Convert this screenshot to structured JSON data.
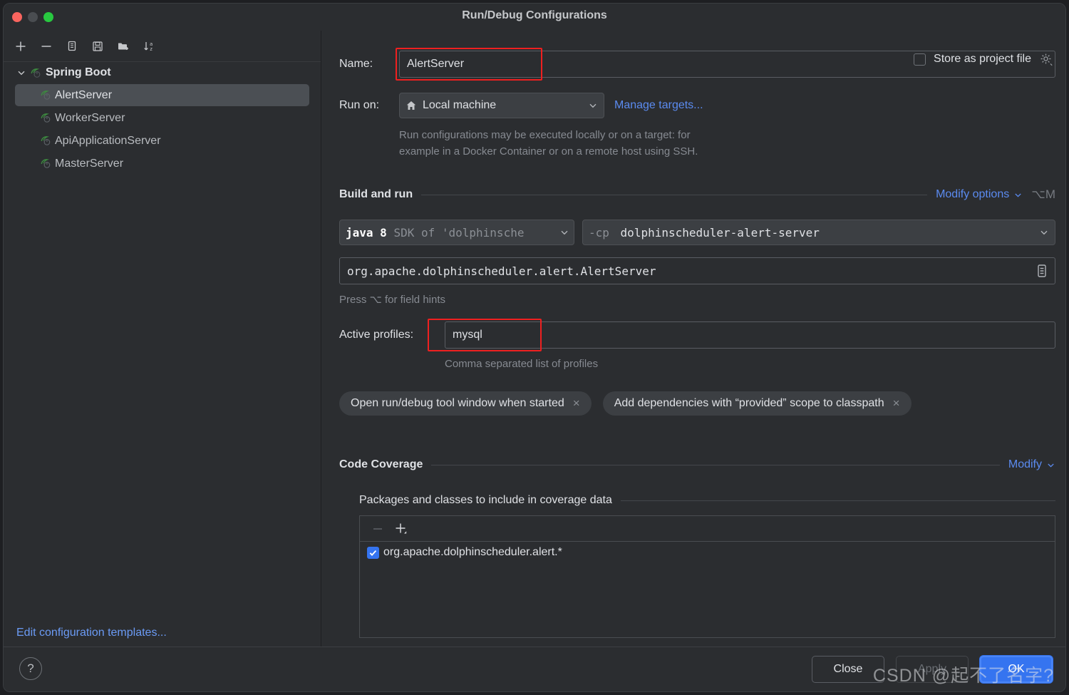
{
  "window": {
    "title": "Run/Debug Configurations",
    "traffic_lights": [
      "close",
      "minimize",
      "zoom"
    ]
  },
  "sidebar": {
    "toolbar": [
      {
        "name": "add-configuration-button",
        "icon": "plus-icon"
      },
      {
        "name": "remove-configuration-button",
        "icon": "minus-icon"
      },
      {
        "name": "copy-configuration-button",
        "icon": "copy-icon"
      },
      {
        "name": "save-configuration-button",
        "icon": "save-icon"
      },
      {
        "name": "move-into-folder-button",
        "icon": "folder-add-icon"
      },
      {
        "name": "sort-configurations-button",
        "icon": "sort-az-icon"
      }
    ],
    "group": {
      "label": "Spring Boot",
      "icon": "spring-boot-icon",
      "expanded": true
    },
    "items": [
      {
        "label": "AlertServer",
        "selected": true
      },
      {
        "label": "WorkerServer",
        "selected": false
      },
      {
        "label": "ApiApplicationServer",
        "selected": false
      },
      {
        "label": "MasterServer",
        "selected": false
      }
    ],
    "edit_templates_link": "Edit configuration templates..."
  },
  "main": {
    "name_label": "Name:",
    "name_value": "AlertServer",
    "name_placeholder": "",
    "store_as_project_file": {
      "label": "Store as project file",
      "checked": false,
      "gear_icon": "gear-icon"
    },
    "run_on_label": "Run on:",
    "run_on_value": "Local machine",
    "run_on_icon": "home-icon",
    "manage_targets_link": "Manage targets...",
    "run_on_hint_line1": "Run configurations may be executed locally or on a target: for",
    "run_on_hint_line2": "example in a Docker Container or on a remote host using SSH.",
    "build_and_run": {
      "section_title": "Build and run",
      "modify_options_link": "Modify options",
      "modify_options_shortcut": "⌥M",
      "jdk_value_strong": "java 8",
      "jdk_value_dim": "SDK of 'dolphinsche",
      "classpath_prefix": "-cp",
      "classpath_value": "dolphinscheduler-alert-server",
      "main_class_value": "org.apache.dolphinscheduler.alert.AlertServer",
      "main_class_browse_icon": "list-browse-icon",
      "field_hints": "Press ⌥ for field hints"
    },
    "active_profiles_label": "Active profiles:",
    "active_profiles_value": "mysql",
    "active_profiles_hint": "Comma separated list of profiles",
    "chips": [
      {
        "label": "Open run/debug tool window when started",
        "close": "×"
      },
      {
        "label": "Add dependencies with “provided” scope to classpath",
        "close": "×"
      }
    ],
    "code_coverage": {
      "section_title": "Code Coverage",
      "modify_link": "Modify",
      "subsection_title": "Packages and classes to include in coverage data",
      "toolbar": [
        {
          "name": "remove-package-button",
          "icon": "minus-icon",
          "disabled": true
        },
        {
          "name": "add-package-button",
          "icon": "plus-dropdown-icon",
          "disabled": false
        }
      ],
      "entries": [
        {
          "label": "org.apache.dolphinscheduler.alert.*",
          "checked": true
        }
      ]
    }
  },
  "footer": {
    "help_icon": "question-mark-icon",
    "close_button": "Close",
    "apply_button": "Apply",
    "ok_button": "OK"
  },
  "watermark": "CSDN @起不了名字?",
  "colors": {
    "accent_blue": "#3574f0",
    "link_blue": "#5b8bf0",
    "highlight_red": "#ef2020",
    "panel_bg": "#2b2d30",
    "selected_row": "#4b4f54"
  }
}
